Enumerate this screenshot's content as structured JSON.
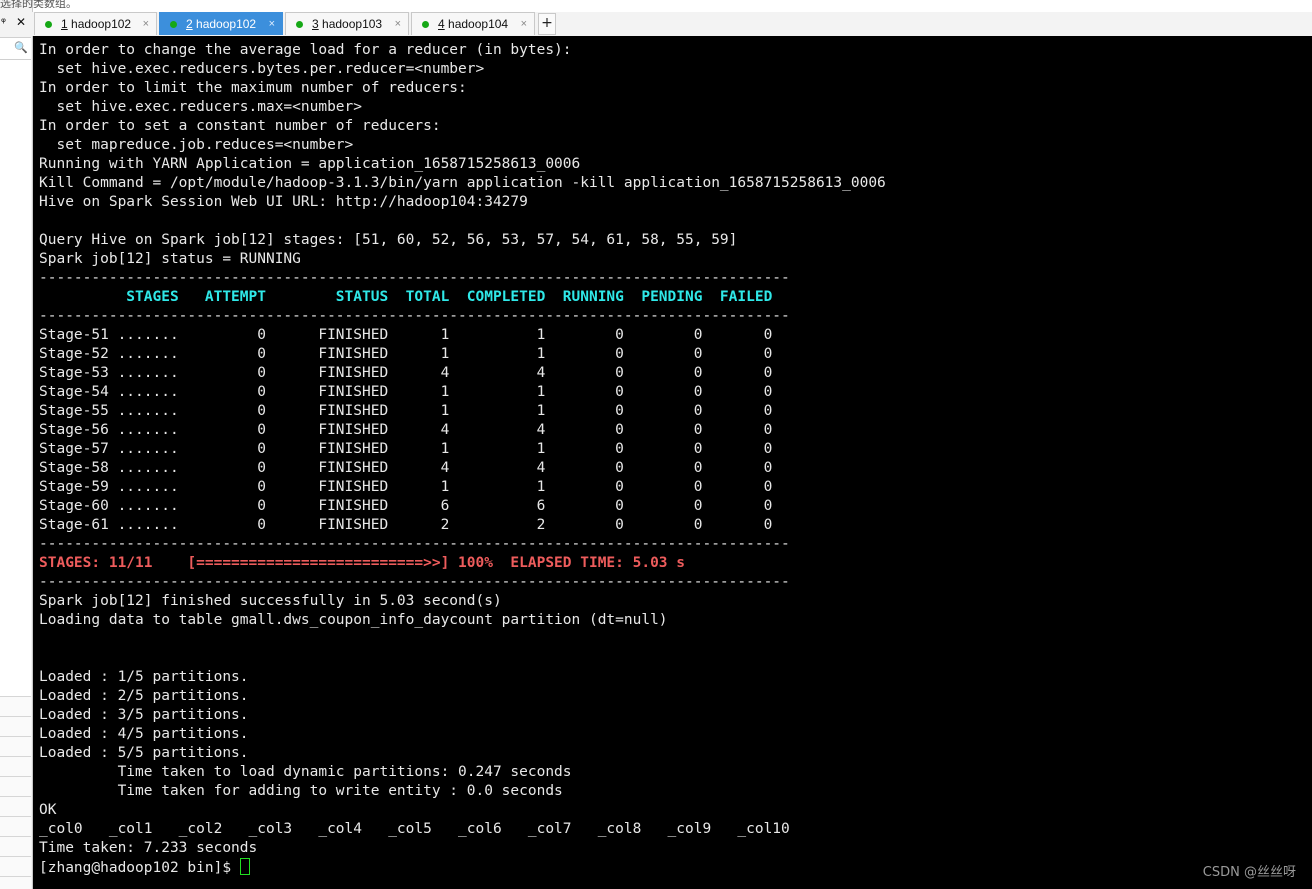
{
  "sidebar": {
    "top_text": "选择的类数组。",
    "pin_glyph": "ᵠ",
    "close_glyph": "✕",
    "search_glyph": "🔍"
  },
  "tabs": [
    {
      "num": "1",
      "name": "hadoop102",
      "close": "×",
      "active": false
    },
    {
      "num": "2",
      "name": "hadoop102",
      "close": "×",
      "active": true
    },
    {
      "num": "3",
      "name": "hadoop103",
      "close": "×",
      "active": false
    },
    {
      "num": "4",
      "name": "hadoop104",
      "close": "×",
      "active": false
    }
  ],
  "new_tab_label": "+",
  "terminal": {
    "lines": [
      "In order to change the average load for a reducer (in bytes):",
      "  set hive.exec.reducers.bytes.per.reducer=<number>",
      "In order to limit the maximum number of reducers:",
      "  set hive.exec.reducers.max=<number>",
      "In order to set a constant number of reducers:",
      "  set mapreduce.job.reduces=<number>",
      "Running with YARN Application = application_1658715258613_0006",
      "Kill Command = /opt/module/hadoop-3.1.3/bin/yarn application -kill application_1658715258613_0006",
      "Hive on Spark Session Web UI URL: http://hadoop104:34279",
      "",
      "Query Hive on Spark job[12] stages: [51, 60, 52, 56, 53, 57, 54, 61, 58, 55, 59]",
      "Spark job[12] status = RUNNING",
      "--------------------------------------------------------------------------------------",
      "          STAGES   ATTEMPT        STATUS  TOTAL  COMPLETED  RUNNING  PENDING  FAILED",
      "--------------------------------------------------------------------------------------",
      "Stage-51 .......         0      FINISHED      1          1        0        0       0",
      "Stage-52 .......         0      FINISHED      1          1        0        0       0",
      "Stage-53 .......         0      FINISHED      4          4        0        0       0",
      "Stage-54 .......         0      FINISHED      1          1        0        0       0",
      "Stage-55 .......         0      FINISHED      1          1        0        0       0",
      "Stage-56 .......         0      FINISHED      4          4        0        0       0",
      "Stage-57 .......         0      FINISHED      1          1        0        0       0",
      "Stage-58 .......         0      FINISHED      4          4        0        0       0",
      "Stage-59 .......         0      FINISHED      1          1        0        0       0",
      "Stage-60 .......         0      FINISHED      6          6        0        0       0",
      "Stage-61 .......         0      FINISHED      2          2        0        0       0",
      "--------------------------------------------------------------------------------------",
      "STAGES: 11/11    [==========================>>] 100%  ELAPSED TIME: 5.03 s",
      "--------------------------------------------------------------------------------------",
      "Spark job[12] finished successfully in 5.03 second(s)",
      "Loading data to table gmall.dws_coupon_info_daycount partition (dt=null)",
      "",
      "",
      "Loaded : 1/5 partitions.",
      "Loaded : 2/5 partitions.",
      "Loaded : 3/5 partitions.",
      "Loaded : 4/5 partitions.",
      "Loaded : 5/5 partitions.",
      "         Time taken to load dynamic partitions: 0.247 seconds",
      "         Time taken for adding to write entity : 0.0 seconds",
      "OK",
      "_col0   _col1   _col2   _col3   _col4   _col5   _col6   _col7   _col8   _col9   _col10",
      "Time taken: 7.233 seconds",
      "[zhang@hadoop102 bin]$ "
    ],
    "header_line_index": 13,
    "progress_line_index": 27,
    "prompt_line_index": 43
  },
  "watermark": "CSDN @丝丝呀",
  "colors": {
    "terminal_bg": "#000000",
    "terminal_fg": "#e8e8e8",
    "header_cyan": "#2fe8e8",
    "progress_red": "#ee5c5c",
    "cursor_green": "#22e022",
    "active_tab_blue": "#3c8fdc",
    "tab_status_dot": "#16a816"
  }
}
